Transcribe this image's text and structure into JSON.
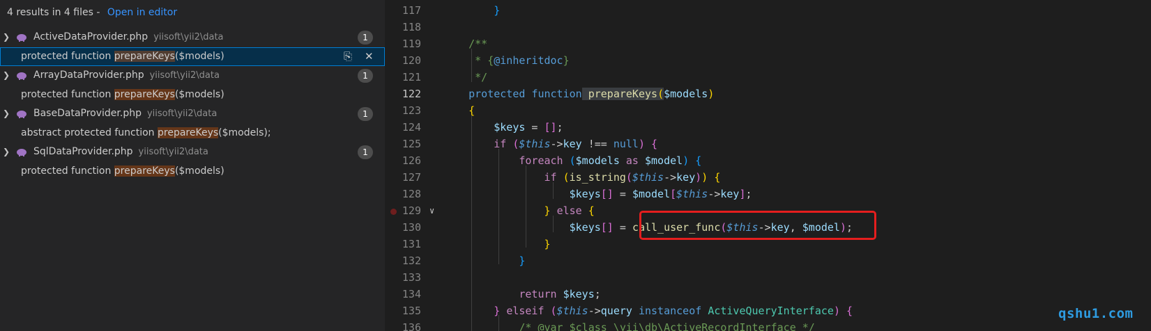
{
  "search": {
    "summary": "4 results in 4 files - ",
    "open_in_editor": "Open in editor",
    "files": [
      {
        "name": "ActiveDataProvider.php",
        "path": "yiisoft\\yii2\\data",
        "count": "1",
        "match_pre": "protected function ",
        "match_hl": "prepareKeys",
        "match_post": "($models)"
      },
      {
        "name": "ArrayDataProvider.php",
        "path": "yiisoft\\yii2\\data",
        "count": "1",
        "match_pre": "protected function ",
        "match_hl": "prepareKeys",
        "match_post": "($models)"
      },
      {
        "name": "BaseDataProvider.php",
        "path": "yiisoft\\yii2\\data",
        "count": "1",
        "match_pre": "abstract protected function ",
        "match_hl": "prepareKeys",
        "match_post": "($models);"
      },
      {
        "name": "SqlDataProvider.php",
        "path": "yiisoft\\yii2\\data",
        "count": "1",
        "match_pre": "protected function ",
        "match_hl": "prepareKeys",
        "match_post": "($models)"
      }
    ],
    "icons": {
      "expanded": "chevron-down-icon",
      "file": "php-elephant-icon",
      "replace": "replace-icon",
      "dismiss": "close-icon"
    }
  },
  "editor": {
    "line_numbers": [
      "117",
      "118",
      "119",
      "120",
      "121",
      "122",
      "123",
      "124",
      "125",
      "126",
      "127",
      "128",
      "129",
      "130",
      "131",
      "132",
      "133",
      "134",
      "135",
      "136"
    ],
    "active_line": "122",
    "breakpoint_line": "129"
  },
  "watermark": "qshu1.com",
  "colors": {
    "highlight_box": "#e51e1e",
    "match_highlight": "#ea5c00"
  }
}
